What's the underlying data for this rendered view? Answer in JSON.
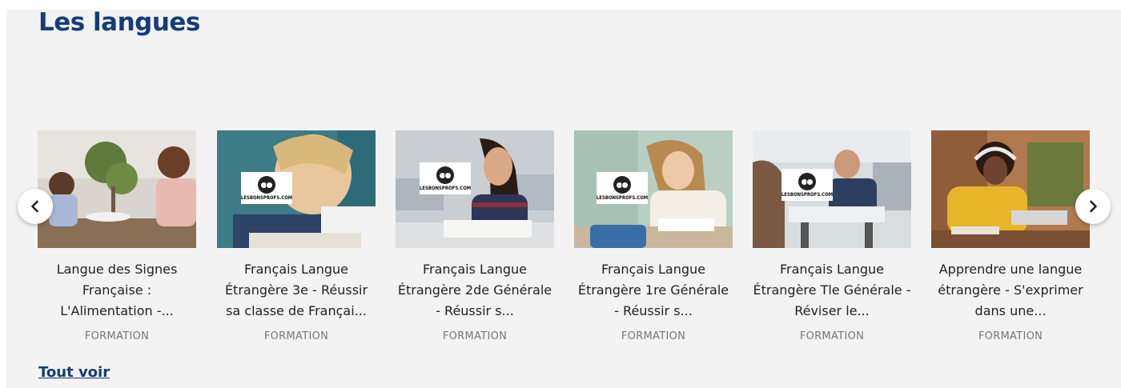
{
  "section": {
    "title": "Les langues",
    "see_all_label": "Tout voir"
  },
  "brand": {
    "logo_text": "LESBONSPROFS.COM"
  },
  "colors": {
    "title": "#143c78",
    "panel_bg": "#f3f3f3",
    "tag": "#777777"
  },
  "carousel": {
    "prev_icon": "chevron-left-icon",
    "next_icon": "chevron-right-icon",
    "cards": [
      {
        "title": "Langue des Signes Française : L'Alimentation -...",
        "tag": "FORMATION"
      },
      {
        "title": "Français Langue Étrangère 3e - Réussir sa classe de Françai...",
        "tag": "FORMATION"
      },
      {
        "title": "Français Langue Étrangère 2de Générale - Réussir s...",
        "tag": "FORMATION"
      },
      {
        "title": "Français Langue Étrangère 1re Générale - Réussir s...",
        "tag": "FORMATION"
      },
      {
        "title": "Français Langue Étrangère Tle Générale - Réviser le...",
        "tag": "FORMATION"
      },
      {
        "title": "Apprendre une langue étrangère - S'exprimer dans une...",
        "tag": "FORMATION"
      }
    ]
  }
}
